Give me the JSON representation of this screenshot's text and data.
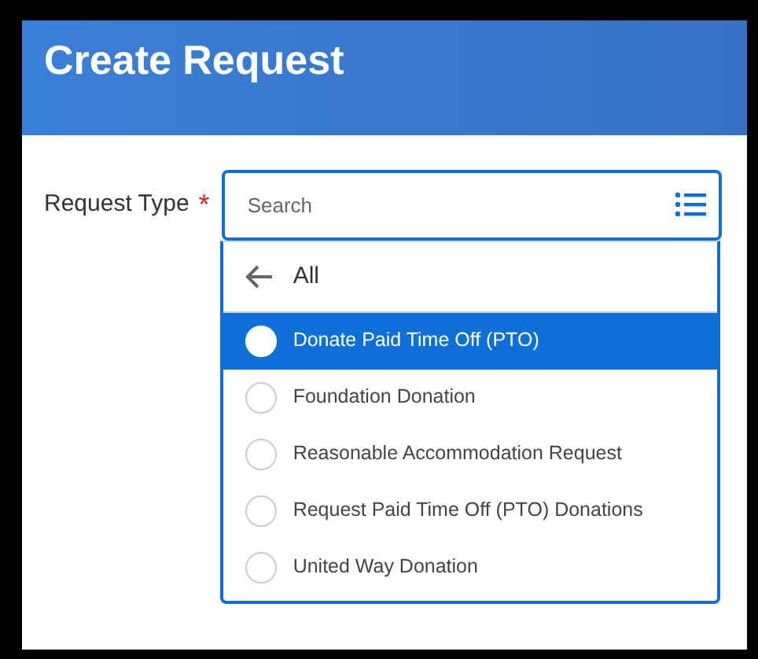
{
  "header": {
    "title": "Create Request"
  },
  "field": {
    "label": "Request Type",
    "required_mark": "*",
    "placeholder": "Search"
  },
  "dropdown": {
    "back": {
      "label": "All"
    },
    "options": [
      {
        "label": "Donate Paid Time Off (PTO)",
        "selected": true
      },
      {
        "label": "Foundation Donation",
        "selected": false
      },
      {
        "label": "Reasonable Accommodation Request",
        "selected": false
      },
      {
        "label": "Request Paid Time Off (PTO) Donations",
        "selected": false
      },
      {
        "label": "United Way Donation",
        "selected": false
      }
    ]
  }
}
